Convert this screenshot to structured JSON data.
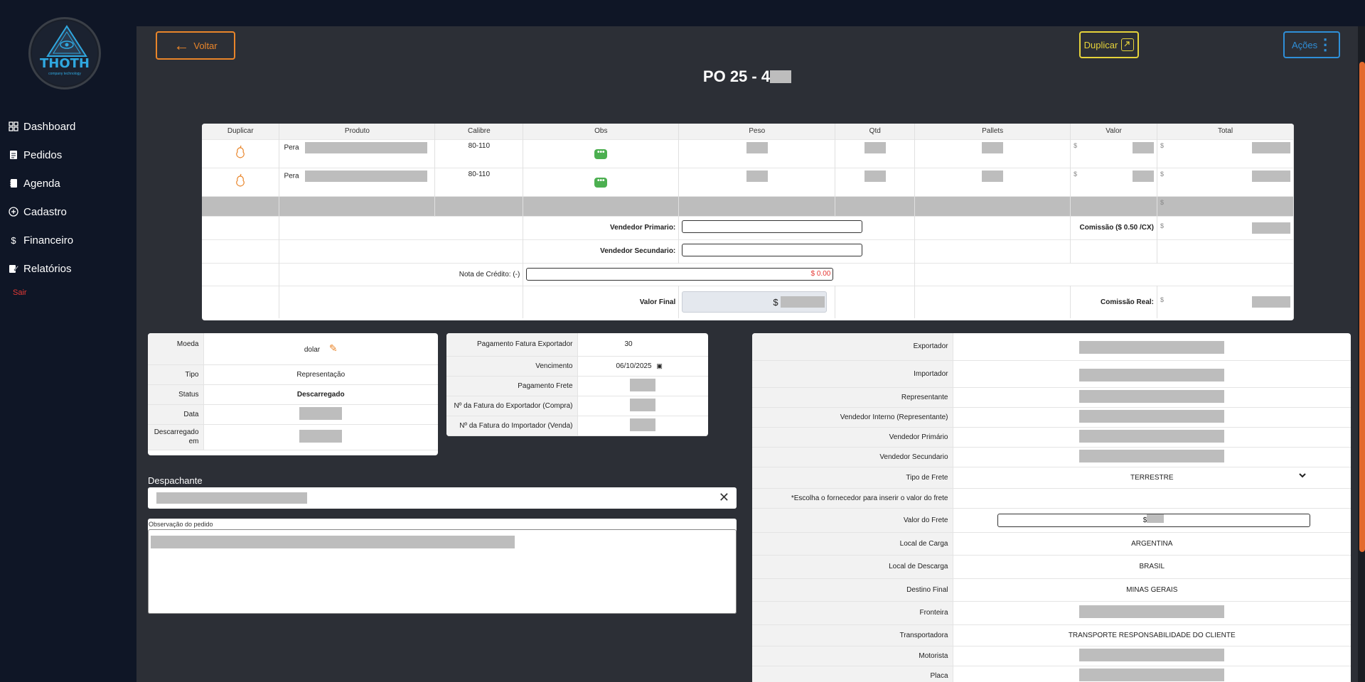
{
  "sidebar": {
    "logo_text": "THOTH",
    "logo_sub": "company technology",
    "items": [
      {
        "label": "Dashboard",
        "icon": "grid-icon"
      },
      {
        "label": "Pedidos",
        "icon": "document-icon"
      },
      {
        "label": "Agenda",
        "icon": "notebook-icon"
      },
      {
        "label": "Cadastro",
        "icon": "plus-circle-icon"
      },
      {
        "label": "Financeiro",
        "icon": "dollar-icon"
      },
      {
        "label": "Relatórios",
        "icon": "report-edit-icon"
      }
    ],
    "logout": "Sair"
  },
  "header": {
    "back_label": "Voltar",
    "duplicate_label": "Duplicar",
    "actions_label": "Ações",
    "title": "PO 25 - 4"
  },
  "products": {
    "columns": [
      "Duplicar",
      "Produto",
      "Calibre",
      "Obs",
      "Peso",
      "Qtd",
      "Pallets",
      "Valor",
      "Total"
    ],
    "rows": [
      {
        "produto": "Pera",
        "calibre": "80-110"
      },
      {
        "produto": "Pera",
        "calibre": "80-110"
      }
    ],
    "currency_symbol": "$",
    "vendedor_primario_label": "Vendedor Primario:",
    "vendedor_secundario_label": "Vendedor Secundario:",
    "comissao_label": "Comissão ($ 0.50 /CX)",
    "nota_credito_label": "Nota de Crédito: (-)",
    "nota_credito_value": "$ 0.00",
    "valor_final_label": "Valor Final",
    "comissao_real_label": "Comissão Real:"
  },
  "info_left": {
    "moeda_label": "Moeda",
    "moeda_value": "dolar",
    "tipo_label": "Tipo",
    "tipo_value": "Representação",
    "status_label": "Status",
    "status_value": "Descarregado",
    "data_label": "Data",
    "descarregado_label": "Descarregado em"
  },
  "info_mid": {
    "pagamento_fatura_label": "Pagamento Fatura Exportador",
    "pagamento_fatura_value": "30",
    "vencimento_label": "Vencimento",
    "vencimento_value": "06/10/2025",
    "pagamento_frete_label": "Pagamento Frete",
    "fatura_exportador_label": "Nº da Fatura do Exportador (Compra)",
    "fatura_importador_label": "Nº da Fatura do Importador (Venda)"
  },
  "info_right": {
    "exportador_label": "Exportador",
    "importador_label": "Importador",
    "representante_label": "Representante",
    "vendedor_interno_label": "Vendedor Interno (Representante)",
    "vendedor_primario_label": "Vendedor Primário",
    "vendedor_secundario_label": "Vendedor Secundario",
    "tipo_frete_label": "Tipo de Frete",
    "tipo_frete_value": "TERRESTRE",
    "frete_warning": "*Escolha o fornecedor para inserir o valor do frete",
    "valor_frete_label": "Valor do Frete",
    "valor_frete_prefix": "$",
    "local_carga_label": "Local de Carga",
    "local_carga_value": "ARGENTINA",
    "local_descarga_label": "Local de Descarga",
    "local_descarga_value": "BRASIL",
    "destino_final_label": "Destino Final",
    "destino_final_value": "MINAS GERAIS",
    "fronteira_label": "Fronteira",
    "transportadora_label": "Transportadora",
    "transportadora_value": "TRANSPORTE RESPONSABILIDADE DO CLIENTE",
    "motorista_label": "Motorista",
    "placa_label": "Placa"
  },
  "despachante": {
    "label": "Despachante"
  },
  "observacao": {
    "label": "Observação do pedido"
  },
  "colors": {
    "accent_orange": "#e9852a",
    "accent_yellow": "#e6d33a",
    "accent_blue": "#2f8fd8",
    "status_purple": "#8e44ad",
    "chat_green": "#4caf50",
    "danger_red": "#e53935"
  }
}
